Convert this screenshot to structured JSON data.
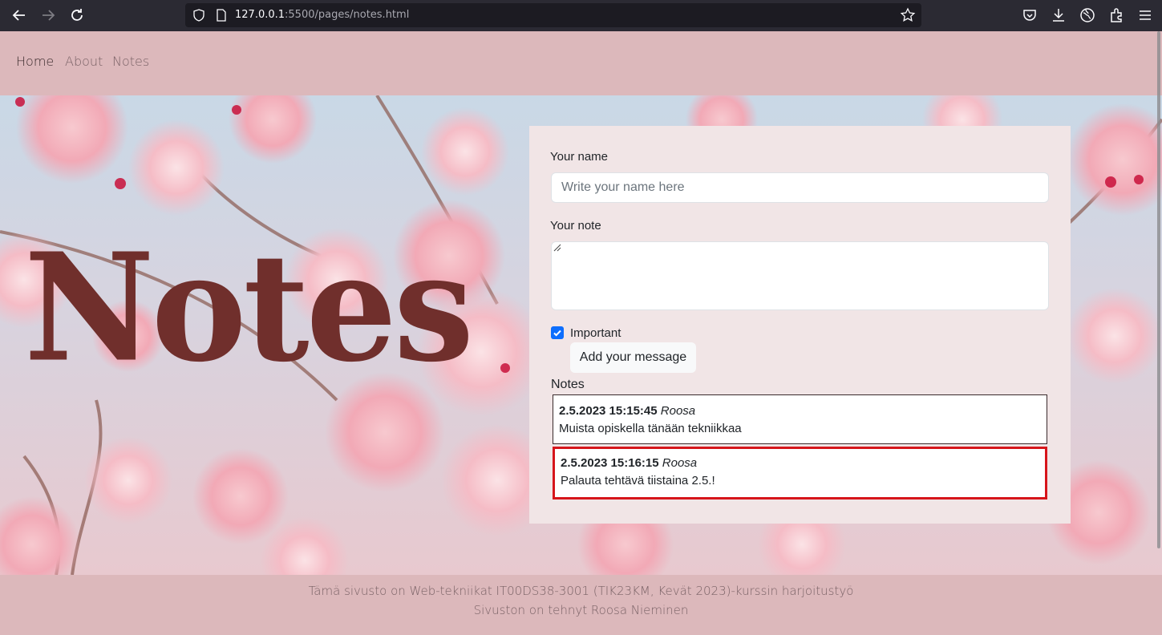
{
  "browser": {
    "url_host": "127.0.0.1",
    "url_rest": ":5500/pages/notes.html",
    "icons": [
      "back-arrow-icon",
      "forward-arrow-icon",
      "reload-icon",
      "shield-icon",
      "page-icon",
      "star-icon",
      "pocket-icon",
      "download-icon",
      "globe-icon",
      "extensions-icon",
      "hamburger-menu-icon"
    ]
  },
  "nav": {
    "items": [
      {
        "label": "Home"
      },
      {
        "label": "About"
      },
      {
        "label": "Notes"
      }
    ]
  },
  "hero": {
    "title": "Notes"
  },
  "form": {
    "name_label": "Your name",
    "name_placeholder": "Write your name here",
    "note_label": "Your note",
    "important_label": "Important",
    "important_checked": true,
    "submit_label": "Add your message"
  },
  "notes": {
    "title": "Notes",
    "items": [
      {
        "date": "2.5.2023 15:15:45",
        "author": "Roosa",
        "text": "Muista opiskella tänään tekniikkaa",
        "important": false
      },
      {
        "date": "2.5.2023 15:16:15",
        "author": "Roosa",
        "text": "Palauta tehtävä tiistaina 2.5.!",
        "important": true
      }
    ]
  },
  "footer": {
    "line1": "Tämä sivusto on Web-tekniikat IT00DS38-3001 (TIK23KM, Kevät 2023)-kurssin harjoitustyö",
    "line2": "Sivuston on tehnyt Roosa Nieminen"
  },
  "colors": {
    "header_bg": "#dcb8bb",
    "title_color": "#702f2c",
    "card_bg": "#f1e5e6",
    "important_border": "#d6151b",
    "checkbox": "#0d6efd"
  }
}
